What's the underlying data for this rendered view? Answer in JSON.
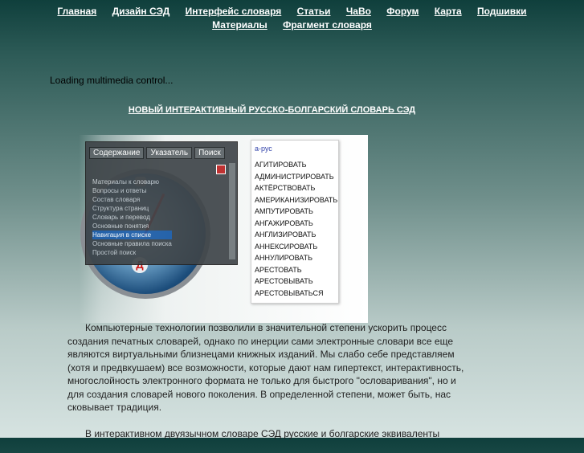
{
  "nav": {
    "row1": [
      "Главная",
      "Дизайн СЭД",
      "Интерфейс словаря",
      "Статьи",
      "ЧаВо",
      "Форум",
      "Карта",
      "Подшивки"
    ],
    "row2": [
      "Материалы",
      "Фрагмент словаря"
    ]
  },
  "loading_text": "Loading multimedia control...",
  "headline": "НОВЫЙ ИНТЕРАКТИВНЫЙ РУССКО-БОЛГАРСКИЙ СЛОВАРЬ СЭД",
  "screenshot": {
    "tabs": [
      "Содержание",
      "Указатель",
      "Поиск"
    ],
    "tree_items": [
      "Материалы к словарю",
      "Вопросы и ответы",
      "Состав словаря",
      "Структура страниц",
      "Словарь и перевод",
      "Основные понятия",
      "Навигация в списке",
      "Основные правила поиска",
      "Простой поиск"
    ],
    "selected_index": 6,
    "clock_letter": "Д",
    "list_header": "а-рус",
    "words": [
      "АГИТИРОВАТЬ",
      "АДМИНИСТРИРОВАТЬ",
      "АКТЁРСТВОВАТЬ",
      "АМЕРИКАНИЗИРОВАТЬ",
      "АМПУТИРОВАТЬ",
      "АНГАЖИРОВАТЬ",
      "АНГЛИЗИРОВАТЬ",
      "АННЕКСИРОВАТЬ",
      "АННУЛИРОВАТЬ",
      "АРЕСТОВАТЬ",
      "АРЕСТОВЫВАТЬ",
      "АРЕСТОВЫВАТЬСЯ"
    ]
  },
  "paragraphs": [
    "Компьютерные технологии позволили в значительной степени ускорить процесс создания печатных словарей, однако по инерции сами электронные словари все еще являются виртуальными близнецами книжных изданий. Мы слабо себе представляем (хотя и предвкушаем) все возможности, которые дают нам гипертекст, интерактивность, многослойность электронного формата не только для быстрого \"ословаривания\", но и для создания словарей нового поколения. В определенной степени, может быть, нас сковывает традиция.",
    "В интерактивном двуязычном словаре СЭД русские и болгарские эквиваленты"
  ]
}
